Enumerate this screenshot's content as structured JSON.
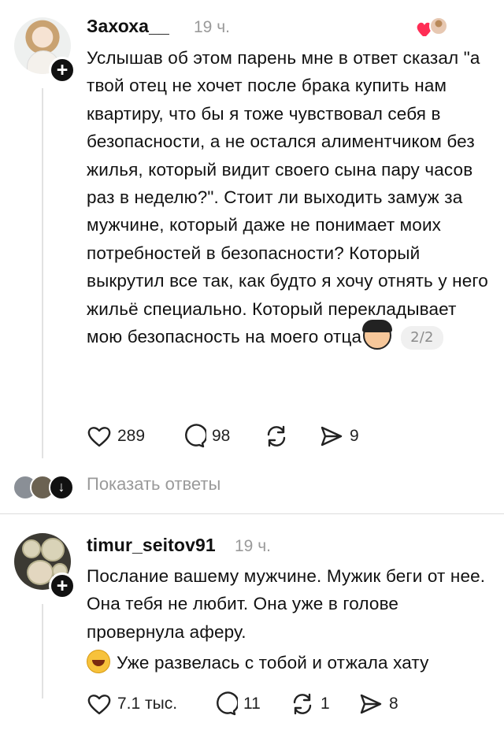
{
  "post1": {
    "username": "Захоха__",
    "time": "19 ч.",
    "text": "Услышав об этом парень мне в ответ сказал \"а твой отец не хочет после брака купить нам квартиру, что бы я тоже чувствовал себя в безопасности, а не остался алиментчиком без жилья, который видит своего сына пару часов раз в неделю?\". Стоит ли выходить замуж за мужчине, который даже не понимает моих потребностей в безопасности? Который выкрутил все так, как будто я хочу отнять у него жильё специально. Который перекладывает мою безопасность на моего отца",
    "page_counter": "2/2",
    "likes": "289",
    "comments": "98",
    "reposts": "",
    "shares": "9"
  },
  "replies": {
    "label": "Показать ответы"
  },
  "post2": {
    "username": "timur_seitov91",
    "time": "19 ч.",
    "text_line1": "Послание вашему мужчине. Мужик беги от нее. Она тебя не любит. Она уже в голове провернула аферу.",
    "text_line2": "Уже развелась с тобой и отжала хату",
    "likes": "7.1 тыс.",
    "comments": "11",
    "reposts": "1",
    "shares": "8"
  },
  "icons": {
    "like": "heart-icon",
    "comment": "comment-bubble-icon",
    "repost": "repost-arrows-icon",
    "share": "send-arrow-icon",
    "follow": "plus-icon"
  },
  "colors": {
    "text": "#111111",
    "muted": "#9a9a9a",
    "heart_red": "#ff2d55"
  }
}
